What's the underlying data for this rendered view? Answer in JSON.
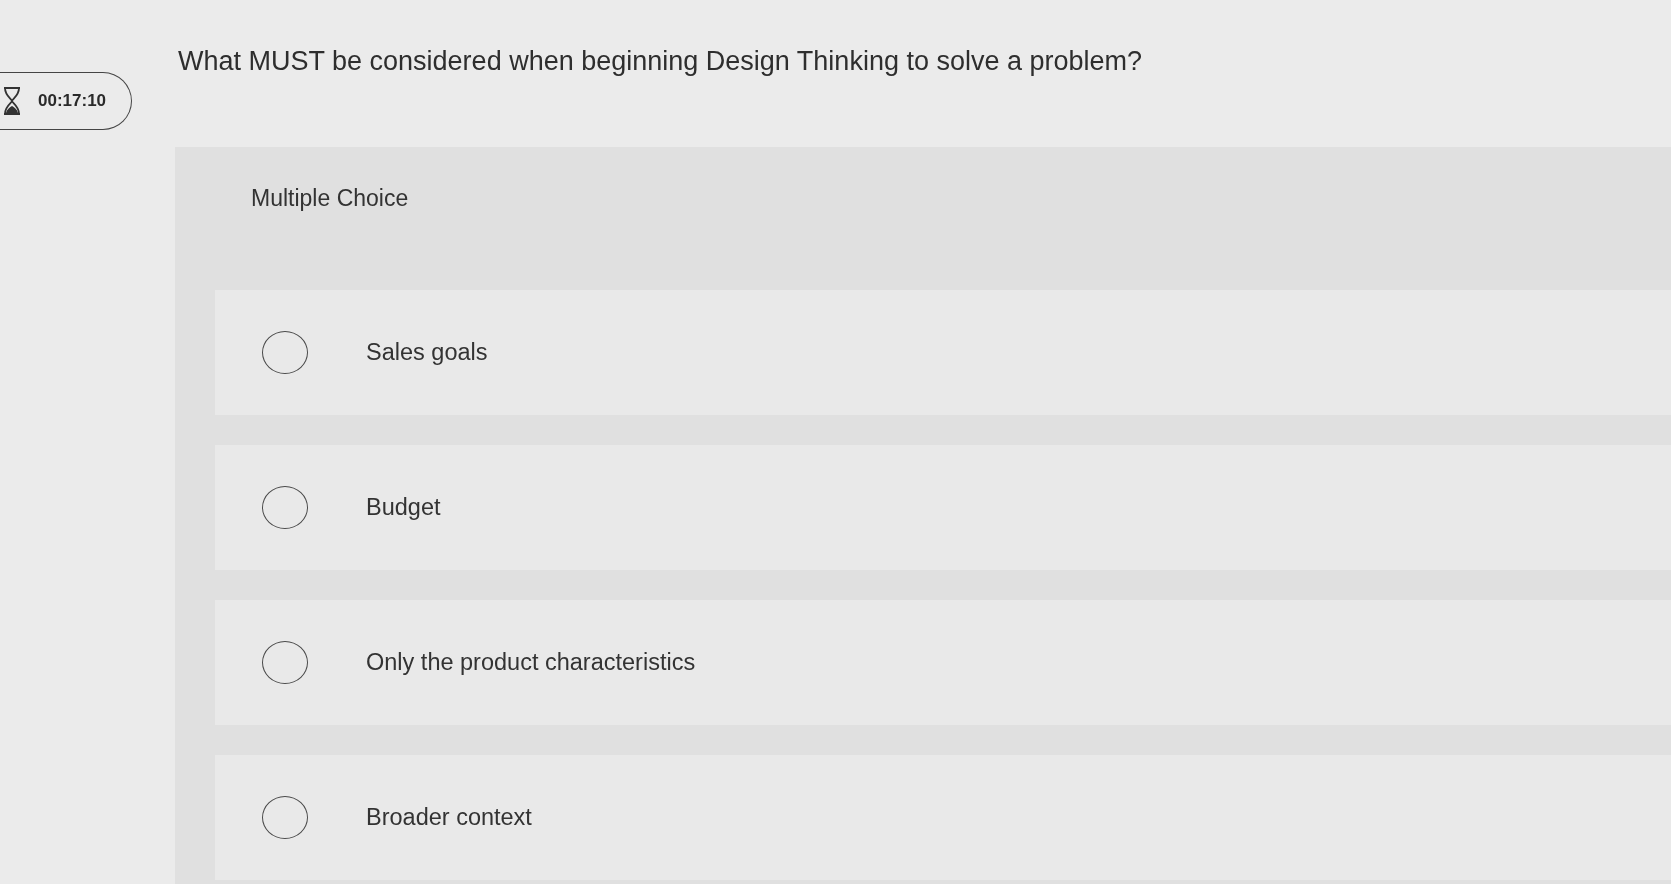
{
  "timer": {
    "time": "00:17:10"
  },
  "question": {
    "text": "What MUST be considered when beginning Design Thinking to solve a problem?"
  },
  "answer_panel": {
    "type_label": "Multiple Choice",
    "choices": [
      {
        "label": "Sales goals",
        "selected": false
      },
      {
        "label": "Budget",
        "selected": false
      },
      {
        "label": "Only the product characteristics",
        "selected": false
      },
      {
        "label": "Broader context",
        "selected": false
      }
    ]
  }
}
